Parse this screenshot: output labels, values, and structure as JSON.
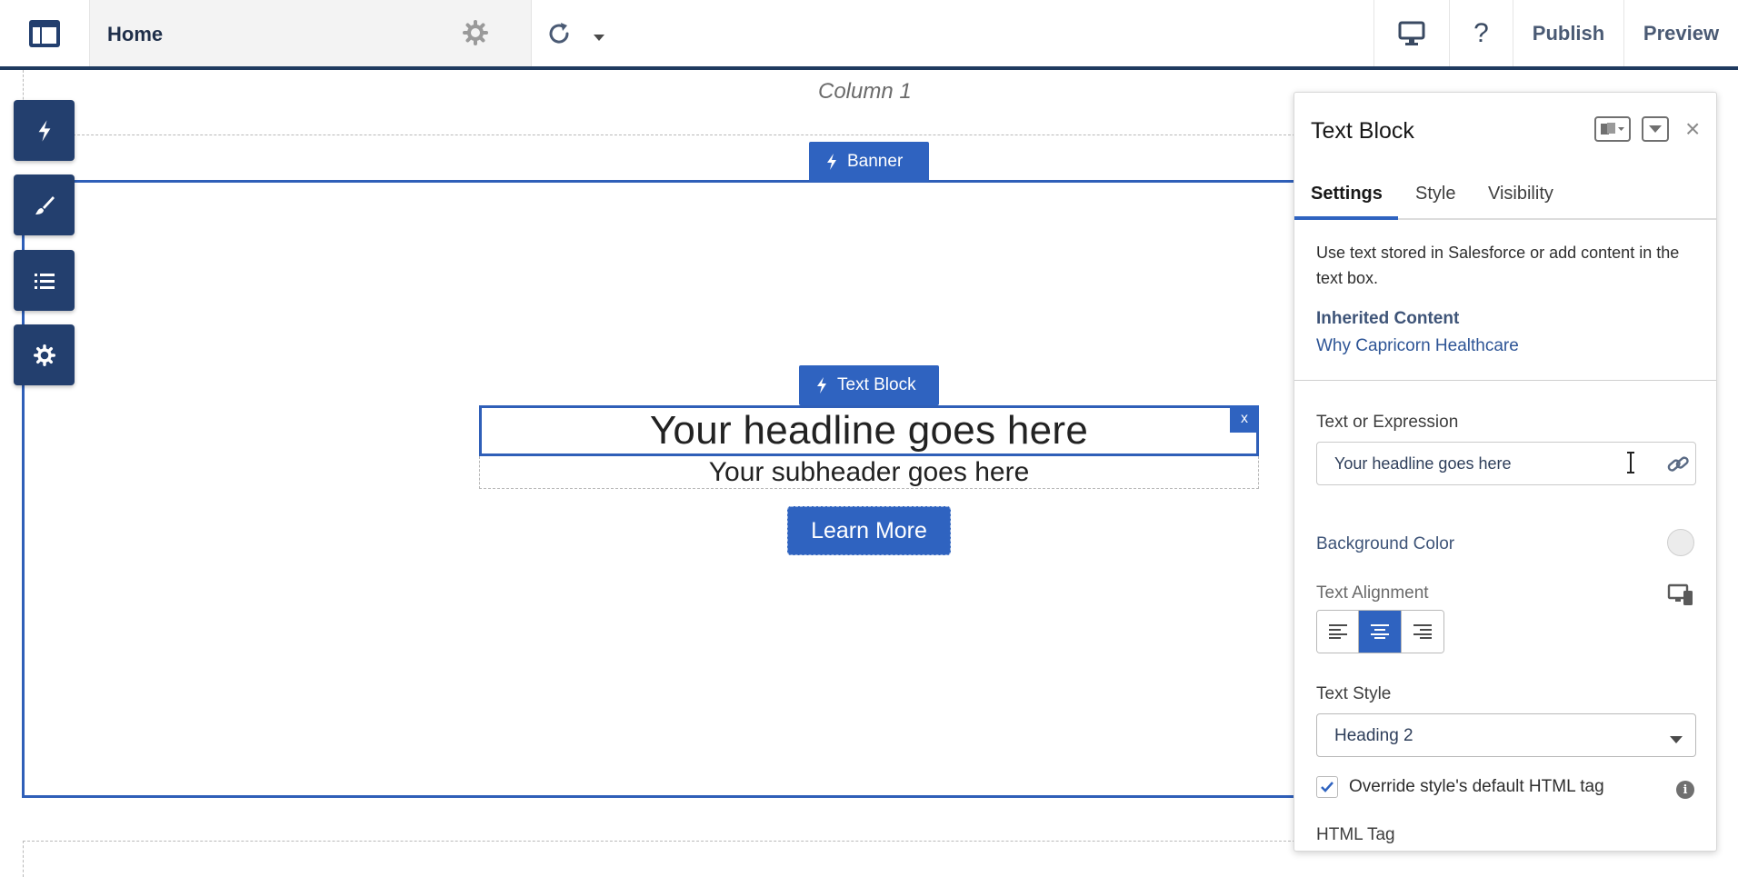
{
  "topbar": {
    "page_name": "Home",
    "help_glyph": "?",
    "publish_label": "Publish",
    "preview_label": "Preview",
    "icons": [
      "layout-icon",
      "gear-icon",
      "chevron-down-icon",
      "refresh-icon",
      "desktop-monitor-icon",
      "help-icon"
    ]
  },
  "canvas": {
    "column_label": "Column 1",
    "banner_tag": "Banner",
    "text_block_tag": "Text Block",
    "headline": "Your headline goes here",
    "close_glyph": "x",
    "subheader": "Your subheader goes here",
    "button_label": "Learn More"
  },
  "rail": {
    "icons": [
      "lightning-icon",
      "brush-icon",
      "list-icon",
      "gear-icon"
    ]
  },
  "panel": {
    "title": "Text Block",
    "close_glyph": "×",
    "tabs": [
      {
        "label": "Settings",
        "active": true
      },
      {
        "label": "Style",
        "active": false
      },
      {
        "label": "Visibility",
        "active": false
      }
    ],
    "description": "Use text stored in Salesforce or add content in the text box.",
    "inherited_title": "Inherited Content",
    "inherited_value": "Why Capricorn Healthcare",
    "text_expr_label": "Text or Expression",
    "text_expr_value": "Your headline goes here",
    "bg_color_label": "Background Color",
    "bg_color_value": "#ececec",
    "text_align_label": "Text Alignment",
    "text_align_selected": "center",
    "text_style_label": "Text Style",
    "text_style_value": "Heading 2",
    "override_label": "Override style's default HTML tag",
    "override_checked": true,
    "info_glyph": "i",
    "html_tag_label": "HTML Tag"
  },
  "colors": {
    "accent": "#2f63c0",
    "rail": "#233f6e",
    "topbar_border": "#1f3a5f"
  }
}
